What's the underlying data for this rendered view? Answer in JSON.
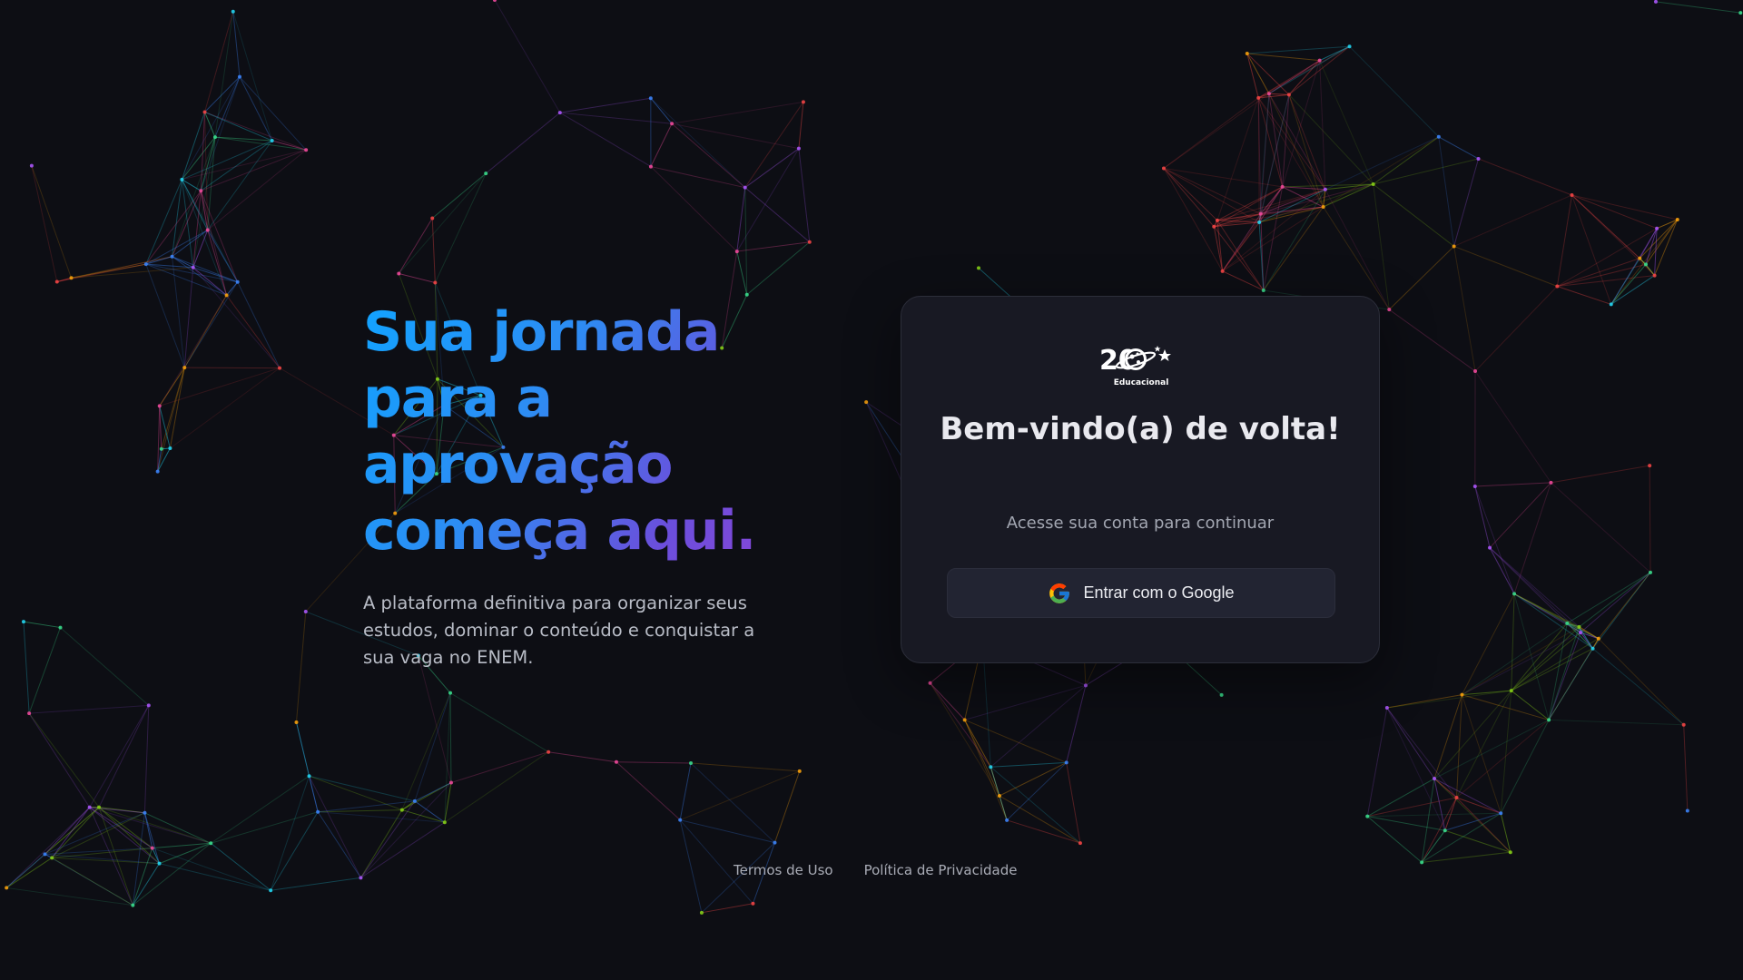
{
  "hero": {
    "heading_lines": [
      "Sua jornada",
      "para a",
      "aprovação",
      "começa aqui."
    ],
    "description": "A plataforma definitiva para organizar seus estudos, dominar o conteúdo e conquistar a sua vaga no ENEM."
  },
  "login_card": {
    "logo": {
      "number": "20",
      "subtitle": "Educacional",
      "icon": "planet-stars-logo"
    },
    "title": "Bem-vindo(a) de volta!",
    "subtitle": "Acesse sua conta para continuar",
    "google_button": {
      "label": "Entrar com o Google",
      "icon": "google-icon"
    }
  },
  "footer": {
    "links": [
      "Termos de Uso",
      "Política de Privacidade"
    ]
  },
  "colors": {
    "background": "#0d0e14",
    "card": "#181923",
    "gradient_start": "#12a3ff",
    "gradient_end": "#8a45d8"
  }
}
